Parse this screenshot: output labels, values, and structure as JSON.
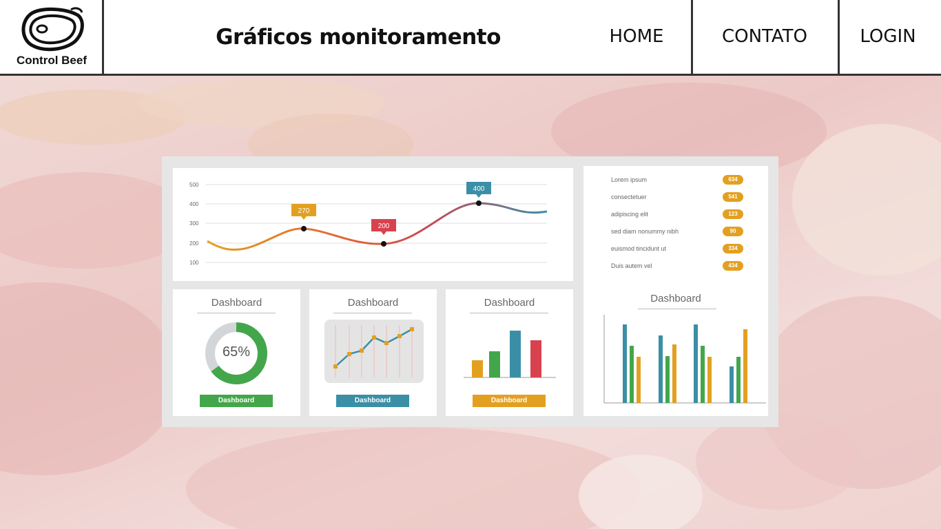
{
  "header": {
    "logo_text": "Control Beef",
    "title": "Gráficos monitoramento",
    "nav": [
      "HOME",
      "CONTATO",
      "LOGIN"
    ]
  },
  "dashboard": {
    "line_chart": {
      "y_ticks": [
        "500",
        "400",
        "300",
        "200",
        "100"
      ],
      "callouts": [
        {
          "label": "270",
          "color": "#e3a020"
        },
        {
          "label": "200",
          "color": "#d9414e"
        },
        {
          "label": "400",
          "color": "#3a8fa6"
        }
      ]
    },
    "legend_list": [
      {
        "label": "Lorem ipsum",
        "value": "634"
      },
      {
        "label": "consectetuer",
        "value": "541"
      },
      {
        "label": "adipiscing elit",
        "value": "123"
      },
      {
        "label": "sed diam nonummy nibh",
        "value": "90"
      },
      {
        "label": "euismod tincidunt ut",
        "value": "334"
      },
      {
        "label": "Duis autem vel",
        "value": "434"
      }
    ],
    "donut": {
      "title": "Dashboard",
      "value_text": "65%",
      "percent": 65,
      "button": "Dashboard",
      "color": "#44a64b"
    },
    "mini_line": {
      "title": "Dashboard",
      "button": "Dashboard",
      "color": "#3a8fa6"
    },
    "mini_bar": {
      "title": "Dashboard",
      "button": "Dashboard",
      "color": "#e3a020"
    },
    "grouped_bar": {
      "title": "Dashboard"
    }
  }
}
